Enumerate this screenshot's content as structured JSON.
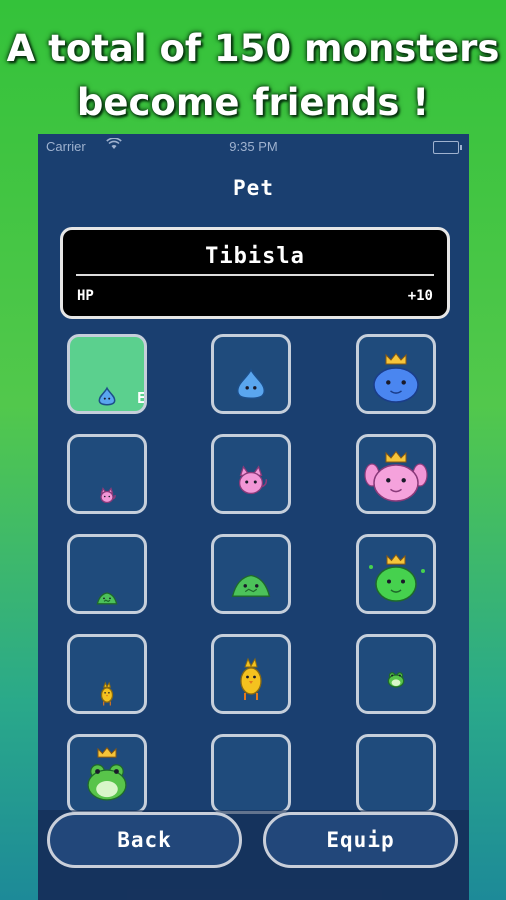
{
  "headline": {
    "line1": "A total of 150 monsters",
    "line2": "become friends !"
  },
  "statusbar": {
    "carrier": "Carrier",
    "time": "9:35 PM"
  },
  "screen_title": "Pet",
  "selected_pet": {
    "name": "Tibisla",
    "stat_label": "HP",
    "stat_value": "+10"
  },
  "equipped_tag": "E",
  "pets": [
    {
      "sprite": "small-blue-slime",
      "selected": true,
      "equipped": true
    },
    {
      "sprite": "blue-slime"
    },
    {
      "sprite": "king-blue-slime"
    },
    {
      "sprite": "small-pink-cat"
    },
    {
      "sprite": "pink-cat"
    },
    {
      "sprite": "king-pink-blob"
    },
    {
      "sprite": "small-green-pile"
    },
    {
      "sprite": "green-pile"
    },
    {
      "sprite": "king-green-slime"
    },
    {
      "sprite": "small-yellow-chick"
    },
    {
      "sprite": "yellow-chick"
    },
    {
      "sprite": "small-green-frog"
    },
    {
      "sprite": "king-green-frog"
    },
    {
      "sprite": "empty"
    },
    {
      "sprite": "empty"
    }
  ],
  "buttons": {
    "back": "Back",
    "equip": "Equip"
  },
  "colors": {
    "selected_cell": "#5bd08e",
    "panel": "#1a3f70",
    "cell": "#1f4b7c"
  }
}
